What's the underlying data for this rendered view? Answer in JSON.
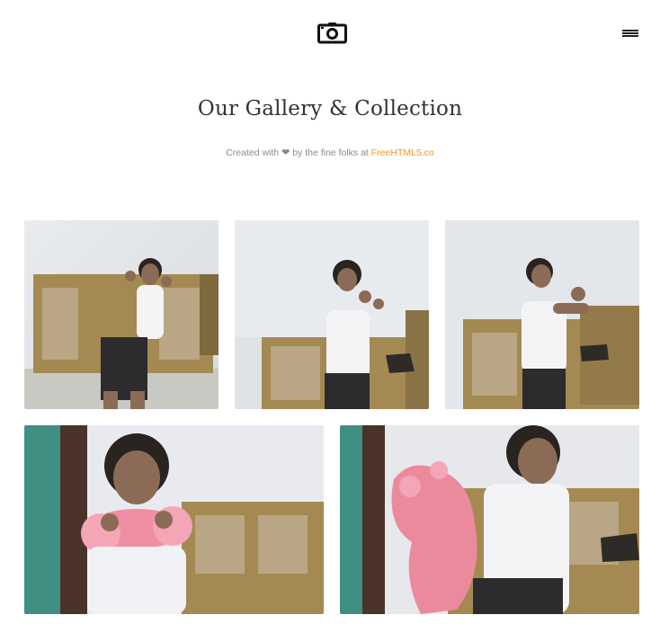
{
  "header": {
    "logo_icon": "camera-icon",
    "menu_icon": "hamburger-menu-icon"
  },
  "hero": {
    "title": "Our Gallery & Collection",
    "credit_prefix": "Created with",
    "credit_heart": "❤",
    "credit_middle": "by the fine folks at",
    "credit_link": "FreeHTML5.co",
    "link_color": "#f7941d"
  },
  "gallery": {
    "items": [
      {
        "subject": "child-posing-hands-up"
      },
      {
        "subject": "child-flexing-arms"
      },
      {
        "subject": "child-crossing-arms"
      },
      {
        "subject": "child-with-pink-neck-pillow"
      },
      {
        "subject": "child-holding-pink-plush"
      }
    ]
  }
}
